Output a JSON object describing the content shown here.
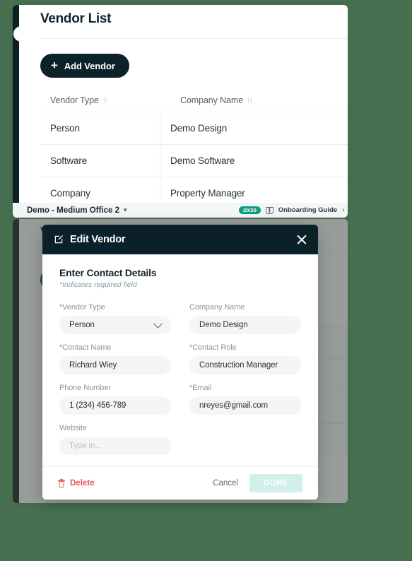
{
  "background_color": "#477050",
  "vendor_list": {
    "title": "Vendor List",
    "add_button_label": "Add Vendor",
    "add_button_icon": "plus-icon",
    "columns": [
      {
        "label": "Vendor Type",
        "sort_icon": "sort-arrows-icon"
      },
      {
        "label": "Company Name",
        "sort_icon": "sort-arrows-icon"
      }
    ],
    "rows": [
      {
        "vendor_type": "Person",
        "company_name": "Demo Design"
      },
      {
        "vendor_type": "Software",
        "company_name": "Demo Software"
      },
      {
        "vendor_type": "Company",
        "company_name": "Property Manager"
      }
    ]
  },
  "status_bar": {
    "project_label": "Demo - Medium Office 2",
    "project_caret_icon": "chevron-down-icon",
    "progress_badge": "20/20",
    "guide_icon": "book-icon",
    "guide_label": "Onboarding Guide",
    "guide_arrow_icon": "chevron-right-icon",
    "badge_color": "#0f9b82"
  },
  "modal": {
    "header": {
      "icon": "edit-pencil-icon",
      "title": "Edit Vendor",
      "close_icon": "close-icon",
      "background_color": "#0b2129"
    },
    "section_title": "Enter Contact Details",
    "required_note": "*Indicates required field",
    "fields": [
      {
        "label": "*Vendor Type",
        "value": "Person",
        "type": "select",
        "placeholder": ""
      },
      {
        "label": "Company Name",
        "value": "Demo Design",
        "type": "text",
        "placeholder": ""
      },
      {
        "label": "*Contact Name",
        "value": "Richard Wiey",
        "type": "text",
        "placeholder": ""
      },
      {
        "label": "*Contact Role",
        "value": "Construction Manager",
        "type": "text",
        "placeholder": ""
      },
      {
        "label": "Phone Number",
        "value": "1 (234) 456-789",
        "type": "text",
        "placeholder": ""
      },
      {
        "label": "*Email",
        "value": "nreyes@gmail.com",
        "type": "text",
        "placeholder": ""
      },
      {
        "label": "Website",
        "value": "",
        "type": "text",
        "placeholder": "Type in..."
      }
    ],
    "footer": {
      "delete_label": "Delete",
      "delete_icon": "trash-icon",
      "delete_color": "#ec5252",
      "cancel_label": "Cancel",
      "done_label": "DONE",
      "done_color": "#d3efea",
      "done_disabled": true
    }
  }
}
